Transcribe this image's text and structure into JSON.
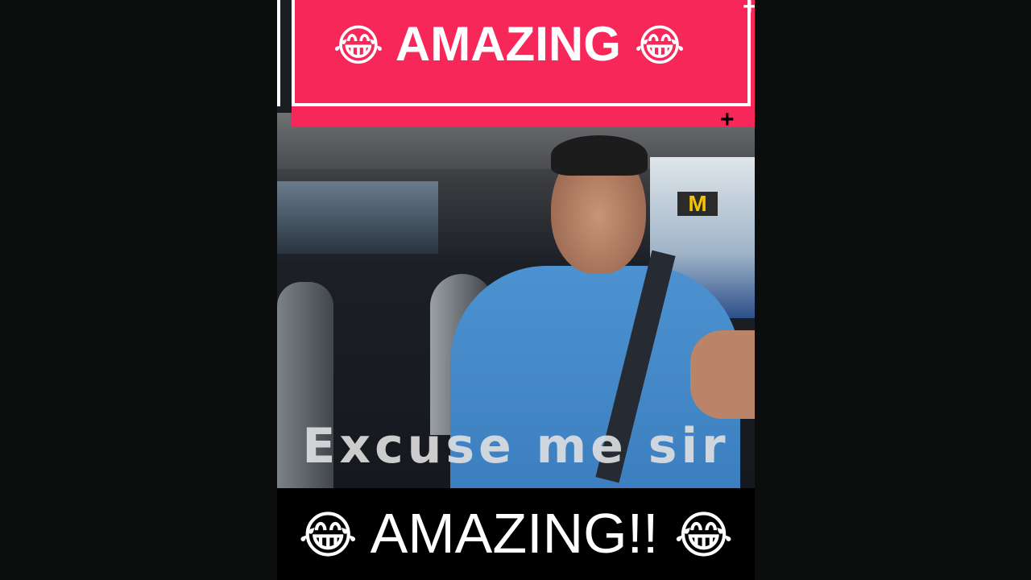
{
  "top_banner": {
    "emoji": "😂",
    "text": "AMAZING",
    "color": "#f7275a"
  },
  "subtitle": "Excuse me sir",
  "bottom_caption": {
    "emoji": "😂",
    "text": "AMAZING!!"
  },
  "sign": "M"
}
